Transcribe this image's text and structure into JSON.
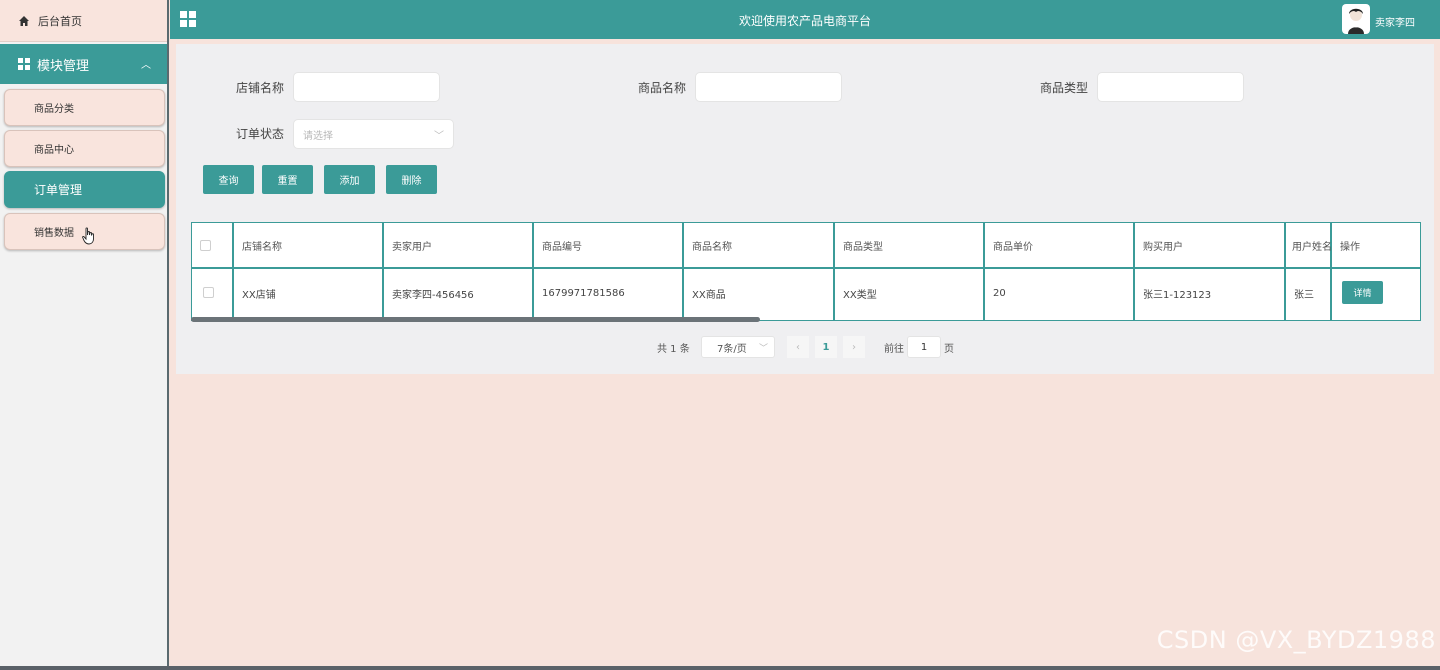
{
  "sidebar": {
    "home_label": "后台首页",
    "module_label": "模块管理",
    "items": [
      {
        "label": "商品分类",
        "active": false
      },
      {
        "label": "商品中心",
        "active": false
      },
      {
        "label": "订单管理",
        "active": true
      },
      {
        "label": "销售数据",
        "active": false
      }
    ]
  },
  "header": {
    "title": "欢迎使用农产品电商平台",
    "user": "卖家李四"
  },
  "filters": {
    "shop_label": "店铺名称",
    "shop_value": "",
    "product_label": "商品名称",
    "product_value": "",
    "type_label": "商品类型",
    "type_value": "",
    "status_label": "订单状态",
    "status_placeholder": "请选择"
  },
  "buttons": {
    "search": "查询",
    "reset": "重置",
    "add": "添加",
    "delete": "删除"
  },
  "table": {
    "columns": [
      "店铺名称",
      "卖家用户",
      "商品编号",
      "商品名称",
      "商品类型",
      "商品单价",
      "购买用户",
      "用户姓名",
      "操作"
    ],
    "rows": [
      {
        "shop": "XX店铺",
        "seller": "卖家李四-456456",
        "code": "1679971781586",
        "name": "XX商品",
        "type": "XX类型",
        "price": "20",
        "buyer": "张三1-123123",
        "buyer_name": "张三",
        "action": "详情"
      }
    ]
  },
  "pagination": {
    "total": "共 1 条",
    "page_size": "7条/页",
    "current": "1",
    "goto_label": "前往",
    "goto_value": "1",
    "page_unit": "页"
  },
  "watermark": "CSDN @VX_BYDZ1988",
  "colors": {
    "accent": "#3b9b98",
    "background": "#f7e3dc"
  }
}
